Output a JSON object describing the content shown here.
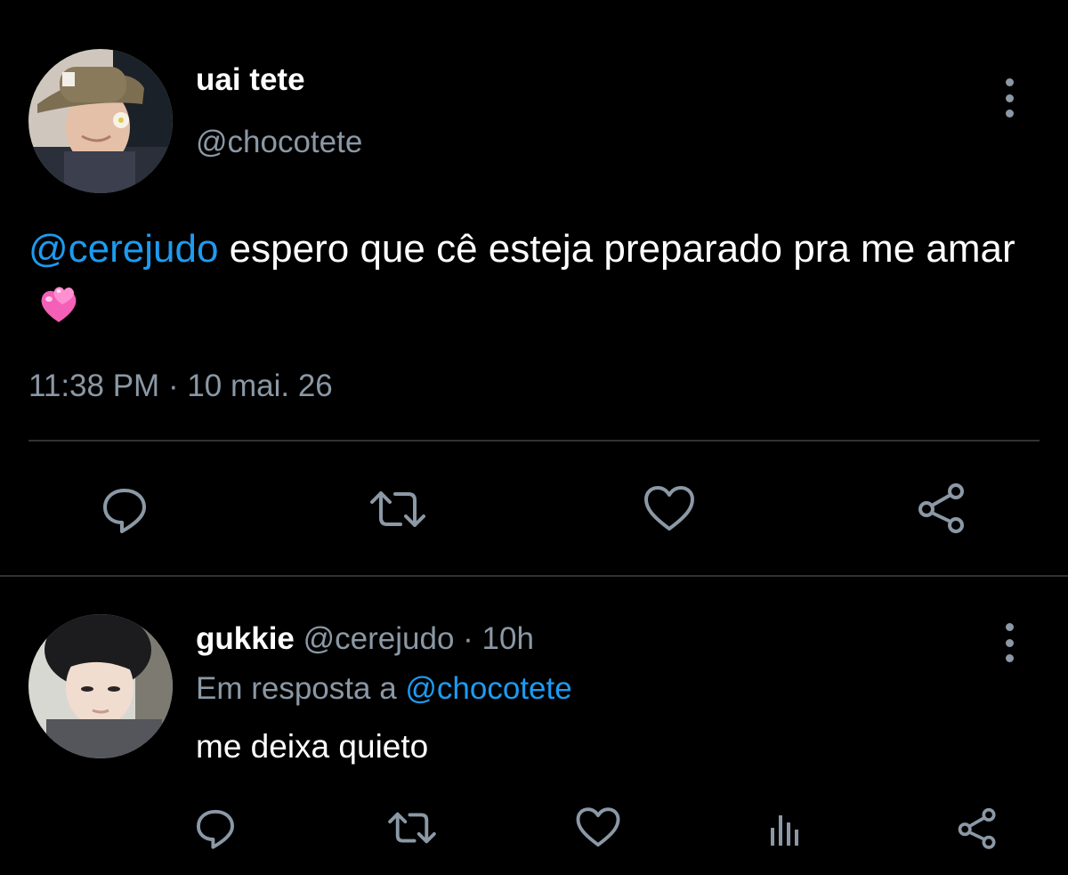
{
  "main_tweet": {
    "author_name": "uai tete",
    "author_handle": "@chocotete",
    "mention": "@cerejudo",
    "text_rest": " espero que cê esteja preparado pra me amar",
    "emoji": "two-hearts-emoji",
    "time": "11:38 PM",
    "separator": "·",
    "date": "10 mai. 26",
    "icons": [
      "reply-icon",
      "retweet-icon",
      "like-icon",
      "share-icon",
      "more-icon"
    ]
  },
  "reply_tweet": {
    "author_name": "gukkie",
    "author_handle": "@cerejudo",
    "separator": "·",
    "time_ago": "10h",
    "in_reply_prefix": "Em resposta a",
    "in_reply_mention": "@chocotete",
    "text": "me deixa quieto",
    "icons": [
      "reply-icon",
      "retweet-icon",
      "like-icon",
      "stats-icon",
      "share-icon",
      "more-icon"
    ]
  },
  "colors": {
    "background": "#000000",
    "text": "#ffffff",
    "secondary": "#8b98a5",
    "link": "#1d9bf0",
    "divider": "#2f3336",
    "emoji_pink": "#f45fb8"
  }
}
